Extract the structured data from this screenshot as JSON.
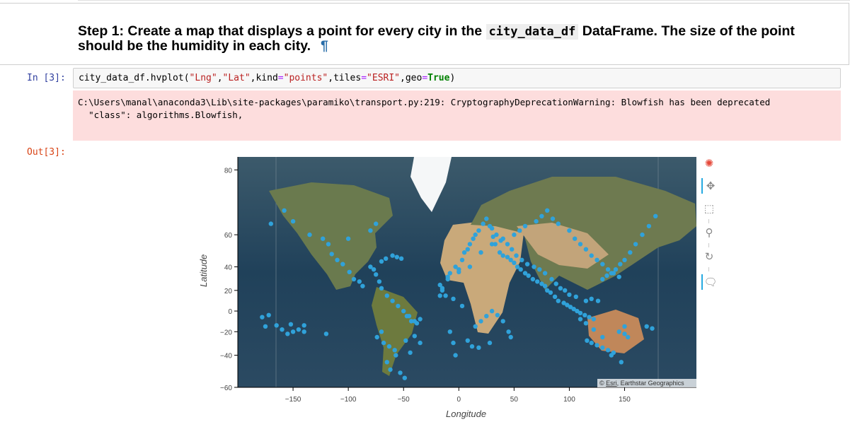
{
  "markdown": {
    "heading_part1": "Step 1: Create a map that displays a point for every city in the ",
    "heading_code": "city_data_df",
    "heading_part2": " DataFrame. The size of the point should be the humidity in each city.",
    "pilcrow": "¶"
  },
  "input_cell": {
    "prompt": "In [3]:",
    "code_parts": {
      "p1": "city_data_df.hvplot(",
      "s1": "\"Lng\"",
      "c1": ",",
      "s2": "\"Lat\"",
      "c2": ",kind",
      "eq1": "=",
      "s3": "\"points\"",
      "c3": ",tiles",
      "eq2": "=",
      "s4": "\"ESRI\"",
      "c4": ",geo",
      "eq3": "=",
      "kw": "True",
      "p2": ")"
    }
  },
  "stderr": {
    "text": "C:\\Users\\manal\\anaconda3\\Lib\\site-packages\\paramiko\\transport.py:219: CryptographyDeprecationWarning: Blowfish has been deprecated\n  \"class\": algorithms.Blowfish,"
  },
  "output_cell": {
    "prompt": "Out[3]:"
  },
  "plot": {
    "ylabel": "Latitude",
    "xlabel": "Longitude",
    "attribution_prefix": "© ",
    "attribution_link": "Esri",
    "attribution_suffix": ", Earthstar Geographics",
    "point_color": "#30a2da",
    "yticks": [
      "80",
      "60",
      "40",
      "20",
      "0",
      "−20",
      "−40",
      "−60"
    ],
    "xticks": [
      "−150",
      "−100",
      "−50",
      "0",
      "50",
      "100",
      "150"
    ]
  },
  "toolbar": {
    "tools": [
      {
        "name": "bokeh-logo-icon",
        "glyph": "✺"
      },
      {
        "name": "pan-icon",
        "glyph": "✥"
      },
      {
        "name": "box-zoom-icon",
        "glyph": "⬚"
      },
      {
        "name": "wheel-zoom-icon",
        "glyph": "⚲"
      },
      {
        "name": "reset-icon",
        "glyph": "↻"
      },
      {
        "name": "hover-icon",
        "glyph": "🗨"
      }
    ]
  },
  "chart_data": {
    "type": "scatter",
    "xlabel": "Longitude",
    "ylabel": "Latitude",
    "xlim": [
      -200,
      215
    ],
    "ylim": [
      -60,
      82
    ],
    "basemap": "ESRI satellite imagery",
    "grid": false,
    "series": [
      {
        "x": [
          -158,
          -150,
          -135,
          -123,
          -118,
          -115,
          -110,
          -105,
          -99,
          -95,
          -90,
          -87,
          -80,
          -77,
          -75,
          -70,
          -66,
          -60,
          -56,
          -52,
          -47,
          -43,
          -35,
          -17,
          -15,
          -10,
          -8,
          -3,
          0,
          3,
          5,
          8,
          10,
          13,
          15,
          18,
          22,
          25,
          28,
          31,
          33,
          37,
          40,
          44,
          47,
          50,
          53,
          56,
          60,
          63,
          67,
          71,
          75,
          78,
          80,
          83,
          87,
          90,
          95,
          98,
          101,
          104,
          107,
          110,
          114,
          118,
          122,
          126,
          130,
          134,
          138,
          142,
          146,
          150,
          155,
          160,
          166,
          172,
          178,
          -170,
          -175,
          -160,
          -140,
          -120,
          -100,
          -80,
          -75,
          -72,
          -70,
          -65,
          -60,
          -55,
          -50,
          -45,
          -40,
          -38,
          -70,
          -74,
          -68,
          -63,
          -58,
          -57,
          -65,
          -62,
          -53,
          -49,
          -44,
          -35,
          -40,
          -48,
          15,
          20,
          25,
          30,
          35,
          40,
          45,
          47,
          28,
          18,
          12,
          8,
          3,
          -5,
          -12,
          -15,
          -17,
          -10,
          0,
          10,
          20,
          30,
          40,
          50,
          55,
          60,
          70,
          75,
          80,
          85,
          90,
          100,
          105,
          110,
          115,
          120,
          125,
          130,
          135,
          140,
          145,
          150,
          153,
          116,
          120,
          125,
          130,
          135,
          140,
          145,
          150,
          115,
          122,
          130,
          138,
          147,
          170,
          175,
          -145,
          -150,
          -155,
          -140,
          -152,
          -165,
          -172,
          -178,
          110,
          115,
          120,
          106,
          100,
          96,
          92,
          88,
          84,
          78,
          73,
          68,
          62,
          57,
          52,
          48,
          44,
          38,
          34,
          30,
          -8,
          -5,
          -3
        ],
        "y": [
          70,
          66,
          60,
          58,
          55,
          49,
          45,
          42,
          36,
          30,
          28,
          24,
          40,
          38,
          34,
          44,
          46,
          48,
          47,
          46,
          -5,
          -10,
          -8,
          15,
          22,
          30,
          35,
          40,
          38,
          45,
          50,
          52,
          55,
          58,
          60,
          62,
          65,
          67,
          64,
          59,
          55,
          50,
          48,
          47,
          45,
          43,
          40,
          38,
          35,
          33,
          30,
          28,
          26,
          24,
          20,
          18,
          14,
          10,
          8,
          6,
          4,
          2,
          0,
          -2,
          -4,
          -6,
          -8,
          10,
          30,
          33,
          35,
          38,
          42,
          45,
          50,
          55,
          60,
          64,
          68,
          65,
          -15,
          -18,
          -20,
          -22,
          58,
          62,
          65,
          28,
          22,
          15,
          10,
          5,
          0,
          -5,
          -10,
          -12,
          -20,
          -25,
          -30,
          -33,
          -36,
          -40,
          -45,
          -50,
          -52,
          -55,
          -38,
          -30,
          -24,
          -28,
          -15,
          -10,
          -5,
          0,
          -4,
          -10,
          -20,
          -25,
          -30,
          -34,
          -33,
          -28,
          5,
          12,
          15,
          20,
          25,
          32,
          36,
          40,
          50,
          55,
          58,
          60,
          62,
          64,
          66,
          68,
          70,
          67,
          65,
          62,
          58,
          55,
          52,
          48,
          45,
          42,
          38,
          35,
          32,
          -22,
          -25,
          -28,
          -30,
          -32,
          -34,
          -36,
          -38,
          -20,
          -15,
          -12,
          -18,
          -25,
          -40,
          -45,
          -15,
          -17,
          -18,
          -20,
          -22,
          -14,
          -13,
          -14,
          -4,
          -6,
          -8,
          10,
          12,
          14,
          16,
          20,
          22,
          26,
          30,
          35,
          38,
          40,
          42,
          45,
          48,
          52,
          55,
          57,
          60,
          63,
          -20,
          -30,
          -40
        ]
      }
    ]
  }
}
